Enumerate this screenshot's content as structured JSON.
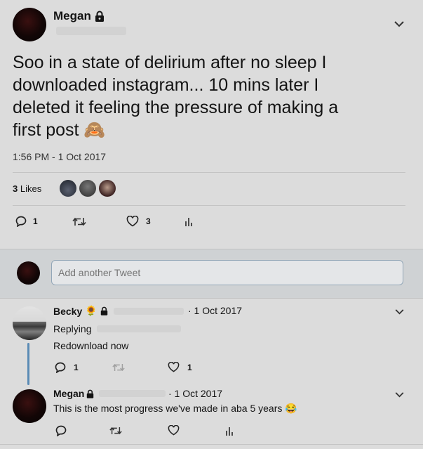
{
  "main_tweet": {
    "author": "Megan",
    "text_lines": [
      "Soo in a state of delirium after no sleep I",
      "downloaded instagram... 10 mins later I",
      "deleted it feeling the pressure of making a",
      "first post 🙈"
    ],
    "timestamp": "1:56 PM - 1 Oct 2017",
    "likes_count": "3",
    "likes_label": "Likes",
    "reply_count": "1",
    "like_count": "3"
  },
  "compose": {
    "placeholder": "Add another Tweet"
  },
  "replies": [
    {
      "author": "Becky",
      "badge_emoji": "🌻",
      "date": "· 1 Oct 2017",
      "replying_label": "Replying",
      "text": "Redownload now",
      "reply_count": "1",
      "like_count": "1"
    },
    {
      "author": "Megan",
      "date": "· 1 Oct 2017",
      "text": "This is the most progress we've made in aba 5 years 😂"
    }
  ],
  "icons": [
    "lock-icon",
    "chevron-down-icon",
    "reply-icon",
    "retweet-icon",
    "like-icon",
    "analytics-icon"
  ],
  "colors": {
    "background": "#dcdcdc",
    "compose_band": "#cfd2d4",
    "input_border": "#93a7b8",
    "thread_line": "#5a8bb5"
  }
}
